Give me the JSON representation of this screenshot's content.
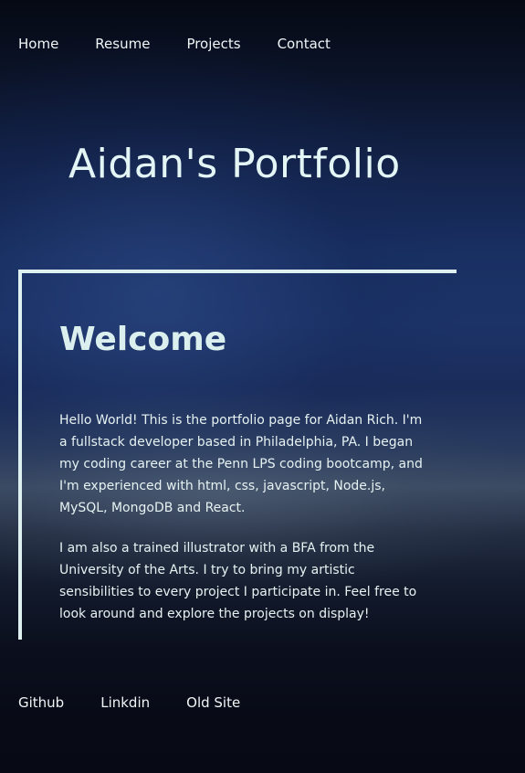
{
  "nav": {
    "items": [
      {
        "label": "Home"
      },
      {
        "label": "Resume"
      },
      {
        "label": "Projects"
      },
      {
        "label": "Contact"
      }
    ]
  },
  "header": {
    "title": "Aidan's Portfolio"
  },
  "main": {
    "heading": "Welcome",
    "paragraphs": [
      "Hello World! This is the portfolio page for Aidan Rich. I'm a fullstack developer based in Philadelphia, PA. I began my coding career at the Penn LPS coding bootcamp, and I'm experienced with html, css, javascript, Node.js, MySQL, MongoDB and React.",
      "I am also a trained illustrator with a BFA from the University of the Arts. I try to bring my artistic sensibilities to every project I participate in. Feel free to look around and explore the projects on display!"
    ]
  },
  "footer": {
    "links": [
      {
        "label": "Github"
      },
      {
        "label": "Linkdin"
      },
      {
        "label": "Old Site"
      }
    ]
  },
  "colors": {
    "text": "#e6f2f2",
    "accent_border": "#dff0f0",
    "background_top": "#050914",
    "background_mid": "#1c3368"
  }
}
